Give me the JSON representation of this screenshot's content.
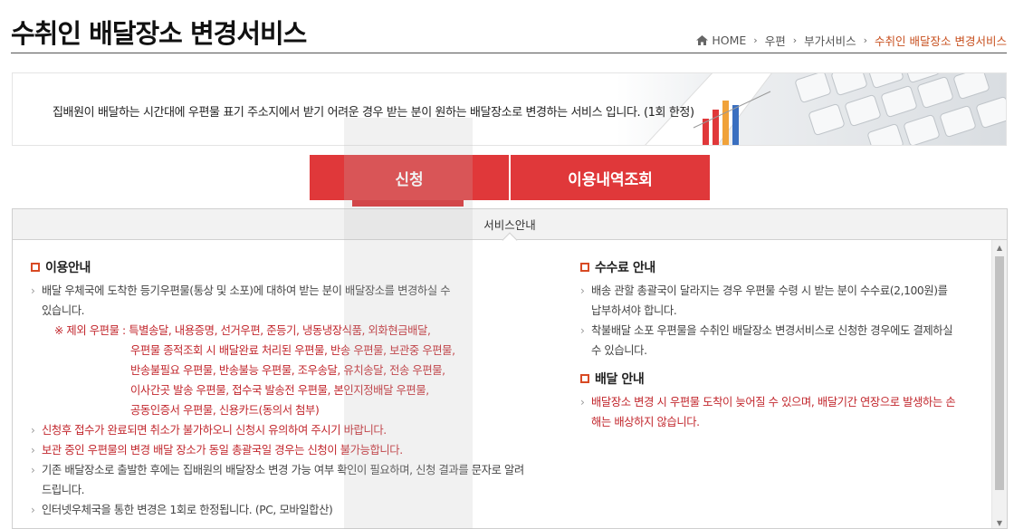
{
  "page": {
    "title": "수취인 배달장소 변경서비스"
  },
  "breadcrumb": {
    "home": "HOME",
    "items": [
      "우편",
      "부가서비스",
      "수취인 배달장소 변경서비스"
    ],
    "separator": "›"
  },
  "banner": {
    "text": "집배원이 배달하는 시간대에 우편물 표기 주소지에서 받기 어려운 경우 받는 분이 원하는 배달장소로 변경하는 서비스 입니다. (1회 한정)"
  },
  "tabs": {
    "apply": "신청",
    "history": "이용내역조회"
  },
  "panel": {
    "header": "서비스안내",
    "usage": {
      "title": "이용안내",
      "item1": "배달 우체국에 도착한 등기우편물(통상 및 소포)에 대하여 받는 분이 배달장소를 변경하실 수",
      "item1_cont": "있습니다.",
      "exclude_lead": "※ 제외 우편물 : 특별송달, 내용증명, 선거우편, 준등기, 냉동냉장식품, 외화현금배달,",
      "exclude_lines": [
        "우편물 종적조회 시 배달완료 처리된 우편물, 반송 우편물, 보관중 우편물,",
        "반송불필요 우편물, 반송불능 우편물, 조우송달, 유치송달, 전송 우편물,",
        "이사간곳 발송 우편물, 접수국 발송전 우편물, 본인지정배달 우편물,",
        "공동인증서 우편물, 신용카드(동의서 첨부)"
      ],
      "item2": "신청후 접수가 완료되면 취소가 불가하오니 신청시 유의하여 주시기 바랍니다.",
      "item3": "보관 중인 우편물의 변경 배달 장소가 동일 총괄국일 경우는 신청이 불가능합니다.",
      "item4": "기존 배달장소로 출발한 후에는 집배원의 배달장소 변경 가능 여부 확인이 필요하며, 신청 결과를 문자로 알려",
      "item4_cont": "드립니다.",
      "item5": "인터넷우체국을 통한 변경은 1회로 한정됩니다. (PC, 모바일합산)"
    },
    "fee": {
      "title": "수수료 안내",
      "item1": "배송 관할 총괄국이 달라지는 경우 우편물 수령 시 받는 분이 수수료(2,100원)를",
      "item1_cont": "납부하셔야 합니다.",
      "item2": "착불배달 소포 우편물을 수취인 배달장소 변경서비스로 신청한 경우에도 결제하실",
      "item2_cont": "수 있습니다."
    },
    "delivery": {
      "title": "배달 안내",
      "item1": "배달장소 변경 시 우편물 도착이 늦어질 수 있으며, 배달기간 연장으로 발생하는 손",
      "item1_cont": "해는 배상하지 않습니다."
    }
  },
  "colors": {
    "accent_red": "#e0383a",
    "text_red": "#c2272d",
    "breadcrumb_current": "#c8501f",
    "bullet_square": "#d84a24"
  },
  "icons": {
    "home": "home-icon",
    "scroll_up": "scroll-up-arrow-icon",
    "scroll_down": "scroll-down-arrow-icon"
  }
}
